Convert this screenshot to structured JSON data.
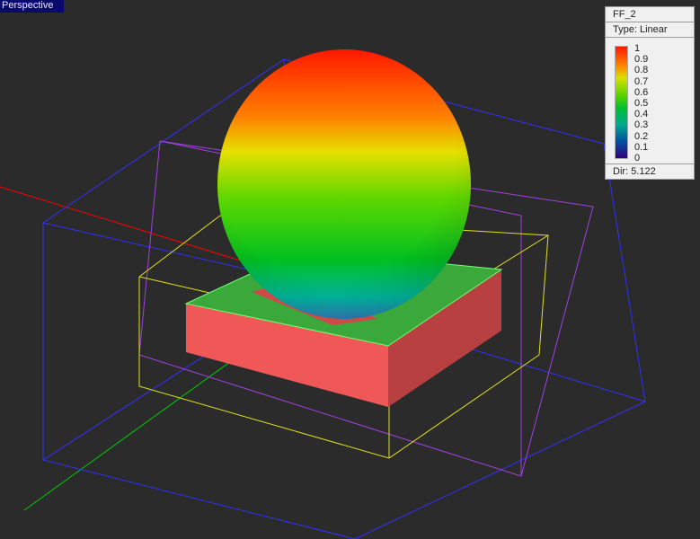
{
  "viewport": {
    "label": "Perspective"
  },
  "legend": {
    "title": "FF_2",
    "type": "Type: Linear",
    "ticks": [
      "1",
      "0.9",
      "0.8",
      "0.7",
      "0.6",
      "0.5",
      "0.4",
      "0.3",
      "0.2",
      "0.1",
      "0"
    ],
    "dir": "Dir: 5.122"
  },
  "colors": {
    "axis_x": "#ff0000",
    "axis_y": "#00cc00",
    "outer_box": "#3030ff",
    "mid_box": "#a040e0",
    "inner_box": "#e0e020",
    "substrate": "#f05050",
    "ground": "#3aa83a"
  }
}
